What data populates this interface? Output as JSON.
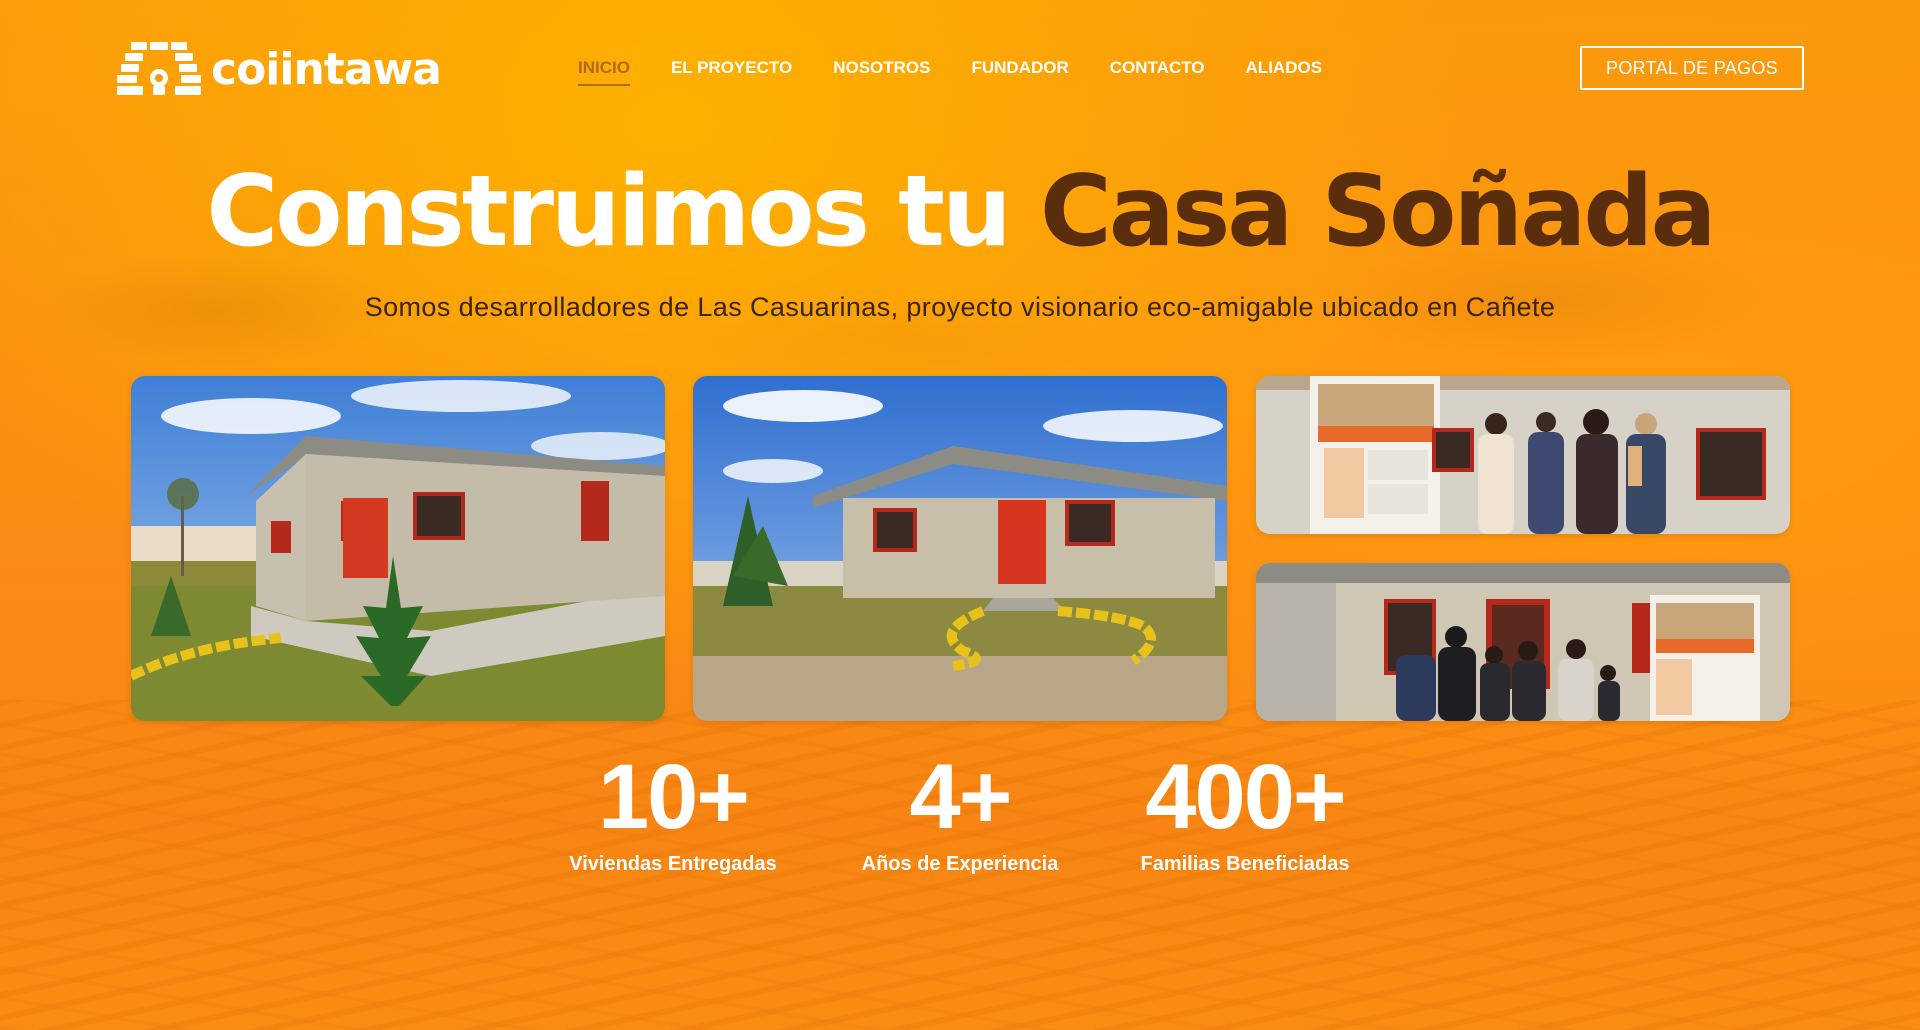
{
  "brand": {
    "name": "coiintawa",
    "logo_icon": "brick-house-icon"
  },
  "nav": {
    "items": [
      {
        "label": "INICIO",
        "active": true
      },
      {
        "label": "EL PROYECTO",
        "active": false
      },
      {
        "label": "NOSOTROS",
        "active": false
      },
      {
        "label": "FUNDADOR",
        "active": false
      },
      {
        "label": "CONTACTO",
        "active": false
      },
      {
        "label": "ALIADOS",
        "active": false
      }
    ],
    "cta_label": "PORTAL DE PAGOS"
  },
  "hero": {
    "title_part1": "Construimos tu ",
    "title_part2": "Casa Soñada",
    "subtitle": "Somos desarrolladores de Las Casuarinas, proyecto visionario eco-amigable ubicado en Cañete"
  },
  "gallery": [
    {
      "subject": "house-photo-1"
    },
    {
      "subject": "house-photo-2"
    },
    {
      "subject": "family-photo-1"
    },
    {
      "subject": "family-photo-2"
    }
  ],
  "stats": [
    {
      "value": "10+",
      "label": "Viviendas Entregadas"
    },
    {
      "value": "4+",
      "label": "Años de Experiencia"
    },
    {
      "value": "400+",
      "label": "Familias Beneficiadas"
    }
  ],
  "colors": {
    "background_orange": "#f98c12",
    "title_dark": "#5a2d0c",
    "subtitle_dark": "#3b2414",
    "active_nav": "#b06a1e",
    "white": "#ffffff"
  }
}
